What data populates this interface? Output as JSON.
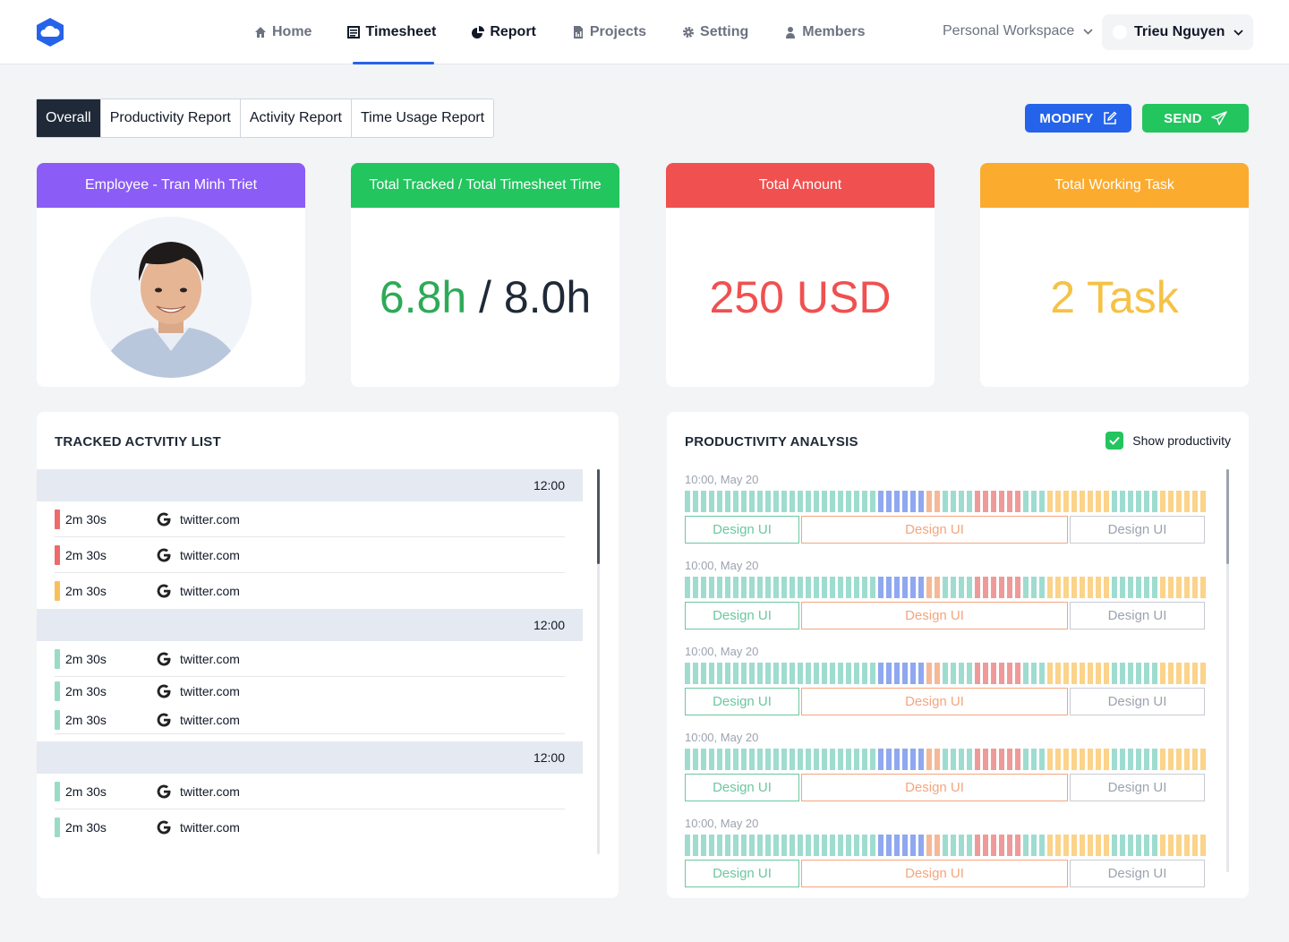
{
  "nav": {
    "items": [
      {
        "label": "Home",
        "icon": "home-icon"
      },
      {
        "label": "Timesheet",
        "icon": "timesheet-icon"
      },
      {
        "label": "Report",
        "icon": "pie-chart-icon"
      },
      {
        "label": "Projects",
        "icon": "document-icon"
      },
      {
        "label": "Setting",
        "icon": "gear-icon"
      },
      {
        "label": "Members",
        "icon": "user-icon"
      }
    ],
    "active": "Timesheet"
  },
  "workspace": {
    "label": "Personal Workspace"
  },
  "user": {
    "name": "Trieu Nguyen"
  },
  "tabs": [
    "Overall",
    "Productivity Report",
    "Activity Report",
    "Time Usage Report"
  ],
  "actions": {
    "modify": "MODIFY",
    "send": "SEND"
  },
  "cards": {
    "employee": {
      "title": "Employee - Tran Minh Triet"
    },
    "tracked": {
      "title": "Total Tracked / Total Timesheet Time",
      "tracked": "6.8h",
      "separator": " / ",
      "total": "8.0h"
    },
    "amount": {
      "title": "Total Amount",
      "value": "250 USD"
    },
    "tasks": {
      "title": "Total Working Task",
      "value": "2 Task"
    }
  },
  "activity": {
    "title": "TRACKED ACTVITIY LIST",
    "groups": [
      {
        "time": "12:00",
        "rows": [
          {
            "duration": "2m 30s",
            "site": "twitter.com",
            "color": "#ec6a6a"
          },
          {
            "duration": "2m 30s",
            "site": "twitter.com",
            "color": "#ec6a6a"
          },
          {
            "duration": "2m 30s",
            "site": "twitter.com",
            "color": "#f8c05a"
          }
        ]
      },
      {
        "time": "12:00",
        "rows": [
          {
            "duration": "2m 30s",
            "site": "twitter.com",
            "color": "#98dcc8"
          },
          {
            "duration": "2m 30s",
            "site": "twitter.com",
            "color": "#98dcc8"
          },
          {
            "duration": "2m 30s",
            "site": "twitter.com",
            "color": "#98dcc8"
          }
        ]
      },
      {
        "time": "12:00",
        "rows": [
          {
            "duration": "2m 30s",
            "site": "twitter.com",
            "color": "#98dcc8"
          },
          {
            "duration": "2m 30s",
            "site": "twitter.com",
            "color": "#98dcc8"
          }
        ]
      }
    ]
  },
  "productivity": {
    "title": "PRODUCTIVITY ANALYSIS",
    "show_label": "Show productivity",
    "show_checked": true,
    "colors": {
      "teal": "#9fdcd0",
      "blue": "#8fa8f0",
      "red": "#ef9a9a",
      "yellow": "#fbd38a",
      "salmon": "#f6b896"
    },
    "rows": [
      {
        "time": "10:00, May 20",
        "tasks": [
          "Design UI",
          "Design UI",
          "Design UI"
        ]
      },
      {
        "time": "10:00, May 20",
        "tasks": [
          "Design UI",
          "Design UI",
          "Design UI"
        ]
      },
      {
        "time": "10:00, May 20",
        "tasks": [
          "Design UI",
          "Design UI",
          "Design UI"
        ]
      },
      {
        "time": "10:00, May 20",
        "tasks": [
          "Design UI",
          "Design UI",
          "Design UI"
        ]
      },
      {
        "time": "10:00, May 20",
        "tasks": [
          "Design UI",
          "Design UI",
          "Design UI"
        ]
      }
    ]
  }
}
